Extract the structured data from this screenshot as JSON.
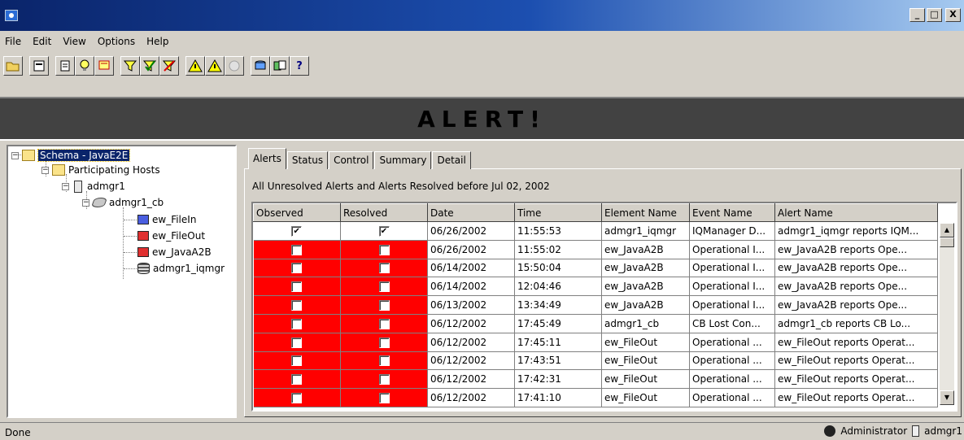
{
  "window": {
    "minimize_label": "_",
    "maximize_label": "□",
    "close_label": "X"
  },
  "menu": [
    "File",
    "Edit",
    "View",
    "Options",
    "Help"
  ],
  "toolbar": {
    "help_label": "?",
    "icons": [
      "open-folder-icon",
      "properties-icon",
      "list-icon",
      "lightbulb-icon",
      "notepad-icon",
      "filter-icon",
      "filter-check-icon",
      "filter-clear-icon",
      "warning-yellow-icon",
      "warning-icon",
      "alert-disabled-icon",
      "database-icon",
      "export-icon",
      "help-icon"
    ]
  },
  "banner": {
    "text": "ALERT!"
  },
  "tree": {
    "root": "Schema - JavaE2E",
    "hosts_folder": "Participating Hosts",
    "host": "admgr1",
    "broker": "admgr1_cb",
    "children": [
      "ew_FileIn",
      "ew_FileOut",
      "ew_JavaA2B",
      "admgr1_iqmgr"
    ]
  },
  "tabs": [
    "Alerts",
    "Status",
    "Control",
    "Summary",
    "Detail"
  ],
  "subtitle": "All Unresolved Alerts and Alerts Resolved before Jul 02, 2002",
  "table": {
    "columns": [
      "Observed",
      "Resolved",
      "Date",
      "Time",
      "Element Name",
      "Event Name",
      "Alert Name"
    ],
    "rows": [
      {
        "observed": true,
        "resolved": true,
        "date": "06/26/2002",
        "time": "11:55:53",
        "element": "admgr1_iqmgr",
        "event": "IQManager D...",
        "alert": "admgr1_iqmgr reports IQM..."
      },
      {
        "observed": false,
        "resolved": false,
        "date": "06/26/2002",
        "time": "11:55:02",
        "element": "ew_JavaA2B",
        "event": "Operational I...",
        "alert": "ew_JavaA2B reports Ope..."
      },
      {
        "observed": false,
        "resolved": false,
        "date": "06/14/2002",
        "time": "15:50:04",
        "element": "ew_JavaA2B",
        "event": "Operational I...",
        "alert": "ew_JavaA2B reports Ope..."
      },
      {
        "observed": false,
        "resolved": false,
        "date": "06/14/2002",
        "time": "12:04:46",
        "element": "ew_JavaA2B",
        "event": "Operational I...",
        "alert": "ew_JavaA2B reports Ope..."
      },
      {
        "observed": false,
        "resolved": false,
        "date": "06/13/2002",
        "time": "13:34:49",
        "element": "ew_JavaA2B",
        "event": "Operational I...",
        "alert": "ew_JavaA2B reports Ope..."
      },
      {
        "observed": false,
        "resolved": false,
        "date": "06/12/2002",
        "time": "17:45:49",
        "element": "admgr1_cb",
        "event": "CB Lost Con...",
        "alert": "admgr1_cb reports CB Lo..."
      },
      {
        "observed": false,
        "resolved": false,
        "date": "06/12/2002",
        "time": "17:45:11",
        "element": "ew_FileOut",
        "event": "Operational ...",
        "alert": "ew_FileOut reports Operat..."
      },
      {
        "observed": false,
        "resolved": false,
        "date": "06/12/2002",
        "time": "17:43:51",
        "element": "ew_FileOut",
        "event": "Operational ...",
        "alert": "ew_FileOut reports Operat..."
      },
      {
        "observed": false,
        "resolved": false,
        "date": "06/12/2002",
        "time": "17:42:31",
        "element": "ew_FileOut",
        "event": "Operational ...",
        "alert": "ew_FileOut reports Operat..."
      },
      {
        "observed": false,
        "resolved": false,
        "date": "06/12/2002",
        "time": "17:41:10",
        "element": "ew_FileOut",
        "event": "Operational ...",
        "alert": "ew_FileOut reports Operat..."
      }
    ]
  },
  "statusbar": {
    "text": "Done",
    "user": "Administrator",
    "host": "admgr1"
  },
  "colors": {
    "titlebar": "#0a246a",
    "unobserved_cell": "#ff0000",
    "banner": "#424242"
  }
}
